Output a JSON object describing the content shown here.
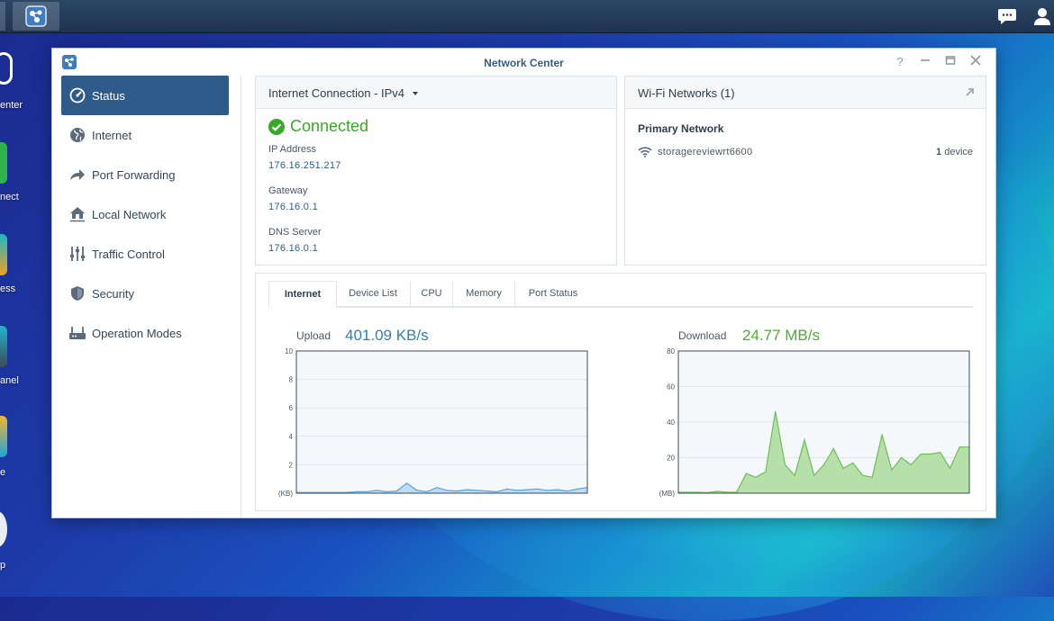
{
  "desktop": {
    "labels": [
      "enter",
      "nect",
      "ess",
      "anel",
      "e",
      "p"
    ]
  },
  "window": {
    "title": "Network Center"
  },
  "sidebar": {
    "items": [
      {
        "label": "Status",
        "icon": "status-gauge-icon",
        "active": true
      },
      {
        "label": "Internet",
        "icon": "globe-icon",
        "active": false
      },
      {
        "label": "Port Forwarding",
        "icon": "forward-arrow-icon",
        "active": false
      },
      {
        "label": "Local Network",
        "icon": "home-network-icon",
        "active": false
      },
      {
        "label": "Traffic Control",
        "icon": "sliders-icon",
        "active": false
      },
      {
        "label": "Security",
        "icon": "shield-icon",
        "active": false
      },
      {
        "label": "Operation Modes",
        "icon": "router-icon",
        "active": false
      }
    ]
  },
  "internet_panel": {
    "title": "Internet Connection - IPv4",
    "status": "Connected",
    "ip_label": "IP Address",
    "ip_value": "176.16.251.217",
    "gateway_label": "Gateway",
    "gateway_value": "176.16.0.1",
    "dns_label": "DNS Server",
    "dns_value": "176.16.0.1"
  },
  "wifi_panel": {
    "title": "Wi-Fi Networks (1)",
    "network_heading": "Primary Network",
    "ssid": "storagereviewrt6600",
    "device_count": "1",
    "device_unit": "device"
  },
  "tabs": [
    "Internet",
    "Device List",
    "CPU",
    "Memory",
    "Port Status"
  ],
  "upload": {
    "label": "Upload",
    "value": "401.09 KB/s",
    "color": "#2c7fb8"
  },
  "download": {
    "label": "Download",
    "value": "24.77 MB/s",
    "color": "#4caf2c"
  },
  "colors": {
    "accent": "#2e5b8a",
    "connected": "#3aa829",
    "upload_fill": "#bcdcf4",
    "upload_line": "#5aa2d8",
    "download_fill": "#b7dfaa",
    "download_line": "#6cbf52"
  },
  "chart_data": [
    {
      "type": "area",
      "title": "Upload",
      "ylabel": "(KB)",
      "ylim": [
        0,
        10
      ],
      "yticks": [
        2,
        4,
        6,
        8,
        10
      ],
      "x": [
        0,
        1,
        2,
        3,
        4,
        5,
        6,
        7,
        8,
        9,
        10,
        11,
        12,
        13,
        14,
        15,
        16,
        17,
        18,
        19,
        20,
        21,
        22,
        23,
        24,
        25,
        26,
        27,
        28,
        29
      ],
      "values": [
        0.05,
        0.05,
        0.05,
        0.05,
        0.05,
        0.05,
        0.1,
        0.1,
        0.2,
        0.1,
        0.15,
        0.7,
        0.2,
        0.1,
        0.4,
        0.2,
        0.15,
        0.25,
        0.2,
        0.15,
        0.1,
        0.3,
        0.2,
        0.25,
        0.3,
        0.2,
        0.25,
        0.15,
        0.3,
        0.4
      ]
    },
    {
      "type": "area",
      "title": "Download",
      "ylabel": "(MB)",
      "ylim": [
        0,
        80
      ],
      "yticks": [
        20,
        40,
        60,
        80
      ],
      "x": [
        0,
        1,
        2,
        3,
        4,
        5,
        6,
        7,
        8,
        9,
        10,
        11,
        12,
        13,
        14,
        15,
        16,
        17,
        18,
        19,
        20,
        21,
        22,
        23,
        24,
        25,
        26,
        27,
        28,
        29,
        30
      ],
      "values": [
        0.5,
        0.5,
        0.5,
        0.3,
        1,
        0.5,
        0.5,
        11,
        9,
        12,
        46,
        16,
        10,
        30,
        10,
        16,
        25,
        14,
        17,
        10,
        9,
        33,
        13,
        20,
        16,
        22,
        22,
        23,
        14,
        26,
        26
      ]
    }
  ]
}
